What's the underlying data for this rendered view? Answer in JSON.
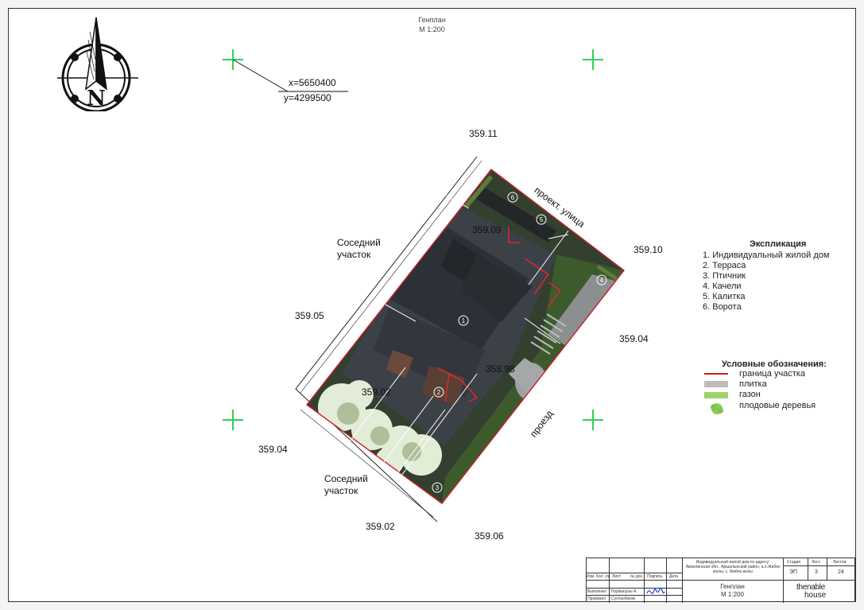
{
  "title": {
    "line1": "Генплан",
    "line2": "М 1:200"
  },
  "coords": {
    "x": "x=5650400",
    "y": "y=4299500"
  },
  "elevations": [
    {
      "id": "e1",
      "value": "359.11"
    },
    {
      "id": "e2",
      "value": "359.09"
    },
    {
      "id": "e3",
      "value": "359.10"
    },
    {
      "id": "e4",
      "value": "359.05"
    },
    {
      "id": "e5",
      "value": "359.04"
    },
    {
      "id": "e6",
      "value": "358.98"
    },
    {
      "id": "e7",
      "value": "359.02"
    },
    {
      "id": "e8",
      "value": "359.04"
    },
    {
      "id": "e9",
      "value": "359.02"
    },
    {
      "id": "e10",
      "value": "359.06"
    }
  ],
  "labels": {
    "neighbor_top": "Соседний\nучасток",
    "neighbor_bottom": "Соседний\nучасток",
    "street": "проект. улица",
    "driveway": "проезд"
  },
  "explication": {
    "heading": "Экспликация",
    "items": [
      "1. Индивидуальный жилой дом",
      "2. Терраса",
      "3. Птичник",
      "4. Качели",
      "5. Калитка",
      "6. Ворота"
    ]
  },
  "legend": {
    "heading": "Условные обозначения:",
    "items": [
      {
        "label": "граница участка",
        "color": "#d11a1a",
        "kind": "line"
      },
      {
        "label": "плитка",
        "color": "#bdbdbd",
        "kind": "bar"
      },
      {
        "label": "газон",
        "color": "#9ed36a",
        "kind": "bar"
      },
      {
        "label": "плодовые деревья",
        "color": "#8fd05b",
        "kind": "tree"
      }
    ]
  },
  "markers": [
    "1",
    "2",
    "3",
    "4",
    "5",
    "6"
  ],
  "compass": {
    "letter": "N"
  },
  "stamp": {
    "address": "Индивидуальный жилой дом по адресу: Акмолинская обл., Аршалынский район, а.о.Жибек жолы, с. Жибек жолы",
    "sheet_title": "Генплан",
    "scale": "М 1:200",
    "stage_label": "Стадия",
    "sheet_label": "Лист",
    "sheets_label": "Листов",
    "stage": "ЭП",
    "sheet": "3",
    "sheets": "24",
    "row_headers": [
      "Изм.",
      "Кол. уч.",
      "Лист",
      "№ док.",
      "Подпись",
      "Дата"
    ],
    "performed_label": "Выполнил",
    "performed_name": "Нуржанулы А.",
    "checked_label": "Проверил",
    "checked_name": "Султанбеков",
    "logo_top": "thenable",
    "logo_bottom": "house"
  }
}
